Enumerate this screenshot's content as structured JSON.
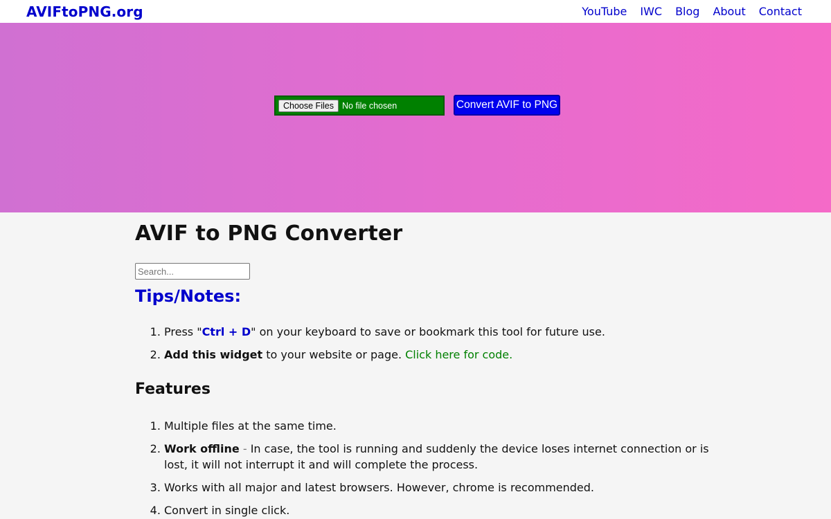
{
  "brand": "AVIFtoPNG.org",
  "nav": {
    "items": [
      "YouTube",
      "IWC",
      "Blog",
      "About",
      "Contact"
    ]
  },
  "hero": {
    "choose_label": "Choose Files",
    "no_file_label": "No file chosen",
    "convert_label": "Convert AVIF to PNG"
  },
  "main": {
    "title": "AVIF to PNG Converter",
    "search_placeholder": "Search...",
    "tips_heading": "Tips/Notes:",
    "tips": [
      {
        "pre": "Press \"",
        "key": "Ctrl + D",
        "post": "\" on your keyboard to save or bookmark this tool for future use."
      },
      {
        "bold": "Add this widget",
        "text": " to your website or page. ",
        "link": "Click here for code",
        "tail": "."
      }
    ],
    "features_heading": "Features",
    "features": [
      {
        "text": "Multiple files at the same time."
      },
      {
        "bold": "Work offline",
        "dash": " - ",
        "text": "In case, the tool is running and suddenly the device loses internet connection or is lost, it will not interrupt it and will complete the process."
      },
      {
        "text": "Works with all major and latest browsers. However, chrome is recommended."
      },
      {
        "text": "Convert in single click."
      }
    ]
  },
  "colors": {
    "brand_blue": "#0000cc",
    "hero_gradient_start": "#d070d2",
    "hero_gradient_end": "#f56ac8",
    "file_input_green": "#008000",
    "convert_button_blue": "#0000ee",
    "link_green": "#008000"
  }
}
